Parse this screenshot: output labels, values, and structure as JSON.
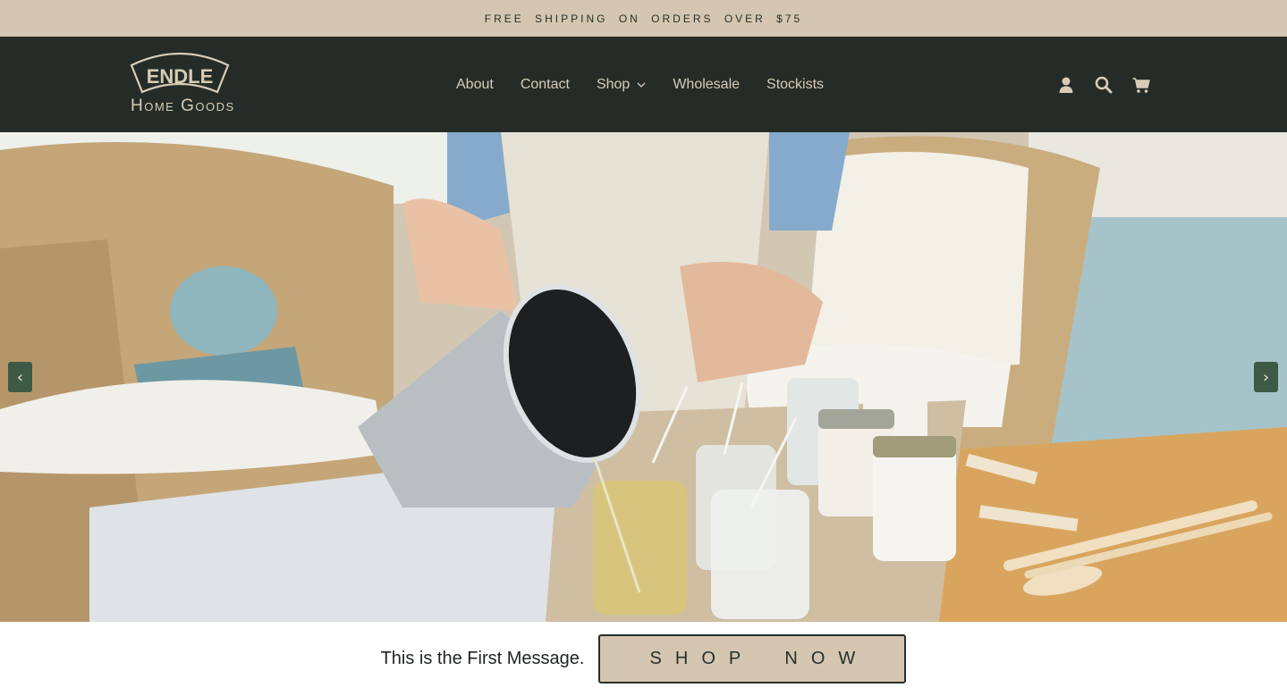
{
  "announcement": {
    "text": "FREE SHIPPING ON ORDERS OVER $75"
  },
  "brand": {
    "logo_word": "ENDLE",
    "logo_subtitle": "Home Goods"
  },
  "nav": {
    "items": [
      {
        "label": "About"
      },
      {
        "label": "Contact"
      },
      {
        "label": "Shop",
        "has_dropdown": true
      },
      {
        "label": "Wholesale"
      },
      {
        "label": "Stockists"
      }
    ]
  },
  "header_icons": [
    "account-icon",
    "search-icon",
    "cart-icon"
  ],
  "slideshow": {
    "prev_label": "‹",
    "next_label": "›"
  },
  "hero_message": {
    "text": "This is the First Message.",
    "button_label": "SHOP NOW"
  },
  "colors": {
    "announcement_bg": "#d4c6b0",
    "header_bg": "#252c28",
    "nav_text": "#d8ccb6",
    "button_bg": "#d4c6b0",
    "slide_arrow_bg": "#3d5a46"
  }
}
